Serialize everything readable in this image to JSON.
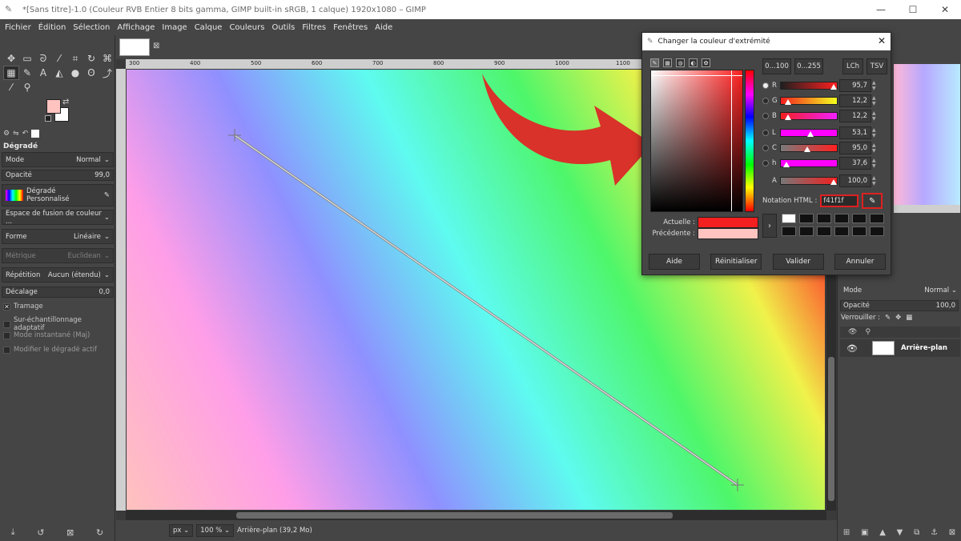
{
  "window": {
    "title": "*[Sans titre]-1.0 (Couleur RVB Entier 8 bits gamma, GIMP built-in sRGB, 1 calque) 1920x1080 – GIMP",
    "minimize": "—",
    "maximize": "☐",
    "close": "✕"
  },
  "menu": [
    "Fichier",
    "Édition",
    "Sélection",
    "Affichage",
    "Image",
    "Calque",
    "Couleurs",
    "Outils",
    "Filtres",
    "Fenêtres",
    "Aide"
  ],
  "toolbox": {
    "tools": [
      "move-icon",
      "rect-select-icon",
      "lasso-icon",
      "fuzzy-select-icon",
      "crop-icon",
      "rotate-icon",
      "warp-icon",
      "text-icon",
      "gradient-icon",
      "paintbrush-icon",
      "bucket-icon",
      "clone-icon",
      "smudge-icon",
      "dodge-icon",
      "path-icon",
      "color-picker-icon",
      "zoom-icon"
    ],
    "fg_color": "#ffc4c0",
    "bg_color": "#ffffff",
    "section_title": "Dégradé",
    "mode_label": "Mode",
    "mode_value": "Normal",
    "opacity_label": "Opacité",
    "opacity_value": "99,0",
    "gradient_label": "Dégradé",
    "gradient_value": "Personnalisé",
    "blend_space": "Espace de fusion de couleur ...",
    "shape_label": "Forme",
    "shape_value": "Linéaire",
    "metric_label": "Métrique",
    "metric_value": "Euclidean",
    "repeat_label": "Répétition",
    "repeat_value": "Aucun (étendu)",
    "offset_label": "Décalage",
    "offset_value": "0,0",
    "dither": "Tramage",
    "supersample": "Sur-échantillonnage adaptatif",
    "instant": "Mode instantané (Maj)",
    "modify_active": "Modifier le dégradé actif"
  },
  "canvas": {
    "ruler_labels": [
      "300",
      "400",
      "500",
      "600",
      "700",
      "800",
      "900",
      "1000",
      "1100"
    ],
    "unit": "px",
    "zoom": "100 %",
    "status": "Arrière-plan (39,2 Mo)"
  },
  "dialog": {
    "title": "Changer la couleur d'extrémité",
    "close": "✕",
    "btn_0_100": "0...100",
    "btn_0_255": "0...255",
    "btn_lch": "LCh",
    "btn_tsv": "TSV",
    "sliders": [
      {
        "label": "R",
        "value": "95,7",
        "knob": 0.957
      },
      {
        "label": "G",
        "value": "12,2",
        "knob": 0.122
      },
      {
        "label": "B",
        "value": "12,2",
        "knob": 0.122
      },
      {
        "label": "L",
        "value": "53,1",
        "knob": 0.531
      },
      {
        "label": "C",
        "value": "95,0",
        "knob": 0.475
      },
      {
        "label": "h",
        "value": "37,6",
        "knob": 0.104
      },
      {
        "label": "A",
        "value": "100,0",
        "knob": 1.0
      }
    ],
    "html_label": "Notation HTML :",
    "html_value": "f41f1f",
    "current_label": "Actuelle :",
    "previous_label": "Précédente :",
    "current_color": "#f41f1f",
    "previous_color": "#ffc4c0",
    "buttons": {
      "help": "Aide",
      "reset": "Réinitialiser",
      "ok": "Valider",
      "cancel": "Annuler"
    }
  },
  "layers": {
    "mode_label": "Mode",
    "mode_value": "Normal",
    "opacity_label": "Opacité",
    "opacity_value": "100,0",
    "lock_label": "Verrouiller :",
    "layer_name": "Arrière-plan"
  }
}
